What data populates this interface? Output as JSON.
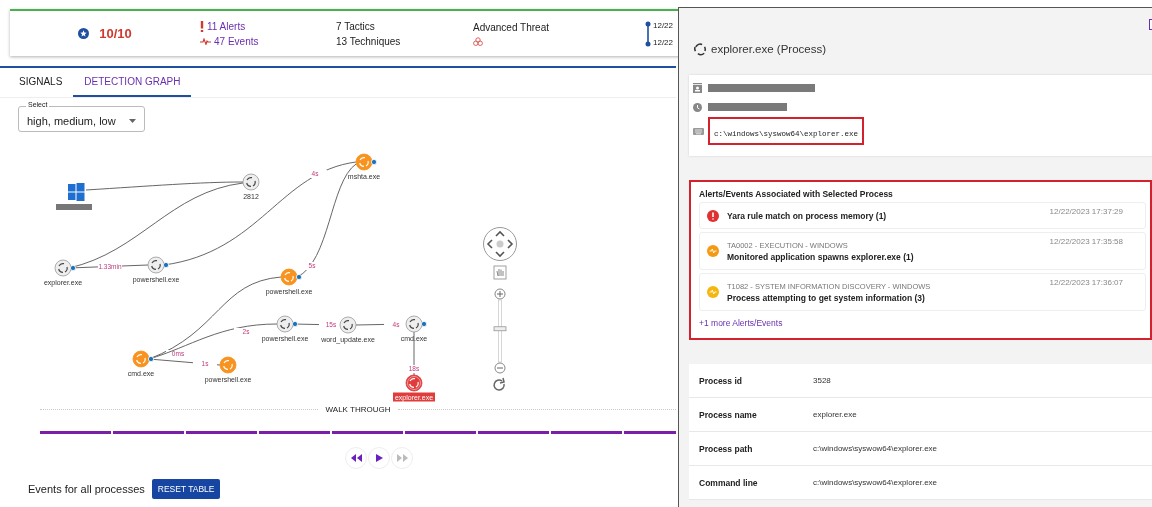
{
  "summary": {
    "score": "10/10",
    "alerts": "11 Alerts",
    "events": "47 Events",
    "tactics": "7 Tactics",
    "techniques": "13 Techniques",
    "threat": "Advanced Threat",
    "timeline": [
      "12/22",
      "12/22"
    ]
  },
  "tabs": [
    {
      "label": "SIGNALS",
      "selected": false
    },
    {
      "label": "DETECTION GRAPH",
      "selected": true
    }
  ],
  "select": {
    "label": "Select",
    "value": "high, medium, low"
  },
  "graph": {
    "nodes": [
      {
        "kind": "host"
      },
      {
        "kind": "process",
        "label": "2812",
        "color": "#eeeeee",
        "has_children": false
      },
      {
        "kind": "process",
        "label": "mshta.exe",
        "color": "#f7931e",
        "has_children": true
      },
      {
        "kind": "process",
        "label": "explorer.exe",
        "color": "#eeeeee",
        "has_children": true
      },
      {
        "kind": "process",
        "label": "powershell.exe",
        "color": "#eeeeee",
        "has_children": true
      },
      {
        "kind": "process",
        "label": "powershell.exe",
        "color": "#f7931e",
        "has_children": true
      },
      {
        "kind": "process",
        "label": "cmd.exe",
        "color": "#f7931e",
        "has_children": true
      },
      {
        "kind": "process",
        "label": "powershell.exe",
        "color": "#f7931e",
        "has_children": false
      },
      {
        "kind": "process",
        "label": "powershell.exe",
        "color": "#eeeeee",
        "has_children": true
      },
      {
        "kind": "process",
        "label": "word_update.exe",
        "color": "#eeeeee",
        "has_children": false
      },
      {
        "kind": "process",
        "label": "cmd.exe",
        "color": "#eeeeee",
        "has_children": true
      },
      {
        "kind": "process",
        "label": "explorer.exe",
        "color": "#e03c3c",
        "has_children": false
      }
    ],
    "edges": [
      {
        "label": "1.33min"
      },
      {
        "label": "4s"
      },
      {
        "label": "5s"
      },
      {
        "label": "0ms"
      },
      {
        "label": "2s"
      },
      {
        "label": "1s"
      },
      {
        "label": "15s"
      },
      {
        "label": "4s"
      },
      {
        "label": "18s"
      }
    ],
    "zoom": {
      "level": 0.53
    }
  },
  "walk_through": {
    "label": "WALK THROUGH",
    "level": 1,
    "controls": [
      {
        "kind": "rewind",
        "disabled": false
      },
      {
        "kind": "play",
        "disabled": false
      },
      {
        "kind": "forward",
        "disabled": true
      }
    ]
  },
  "events_bar": {
    "label": "Events for all processes",
    "button": "RESET TABLE"
  },
  "panel": {
    "title": "explorer.exe (Process)",
    "path": "c:\\windows\\syswow64\\explorer.exe",
    "alerts_title": "Alerts/Events Associated with Selected Process",
    "alerts": [
      {
        "kind": "alert",
        "name": "Yara rule match on process memory (1)",
        "time": "12/22/2023 17:37:29",
        "color": "#e03030"
      },
      {
        "kind": "event",
        "category": "TA0002 - EXECUTION - WINDOWS",
        "name": "Monitored application spawns explorer.exe (1)",
        "time": "12/22/2023 17:35:58",
        "color": "#f39a12"
      },
      {
        "kind": "event",
        "category": "T1082 - SYSTEM INFORMATION DISCOVERY - WINDOWS",
        "name": "Process attempting to get system information (3)",
        "time": "12/22/2023 17:36:07",
        "color": "#f5b70f"
      }
    ],
    "more": "+1 more Alerts/Events",
    "details": [
      {
        "label": "Process id",
        "value": "3528"
      },
      {
        "label": "Process name",
        "value": "explorer.exe"
      },
      {
        "label": "Process path",
        "value": "c:\\windows\\syswow64\\explorer.exe"
      },
      {
        "label": "Command line",
        "value": "c:\\windows\\syswow64\\explorer.exe"
      }
    ]
  }
}
